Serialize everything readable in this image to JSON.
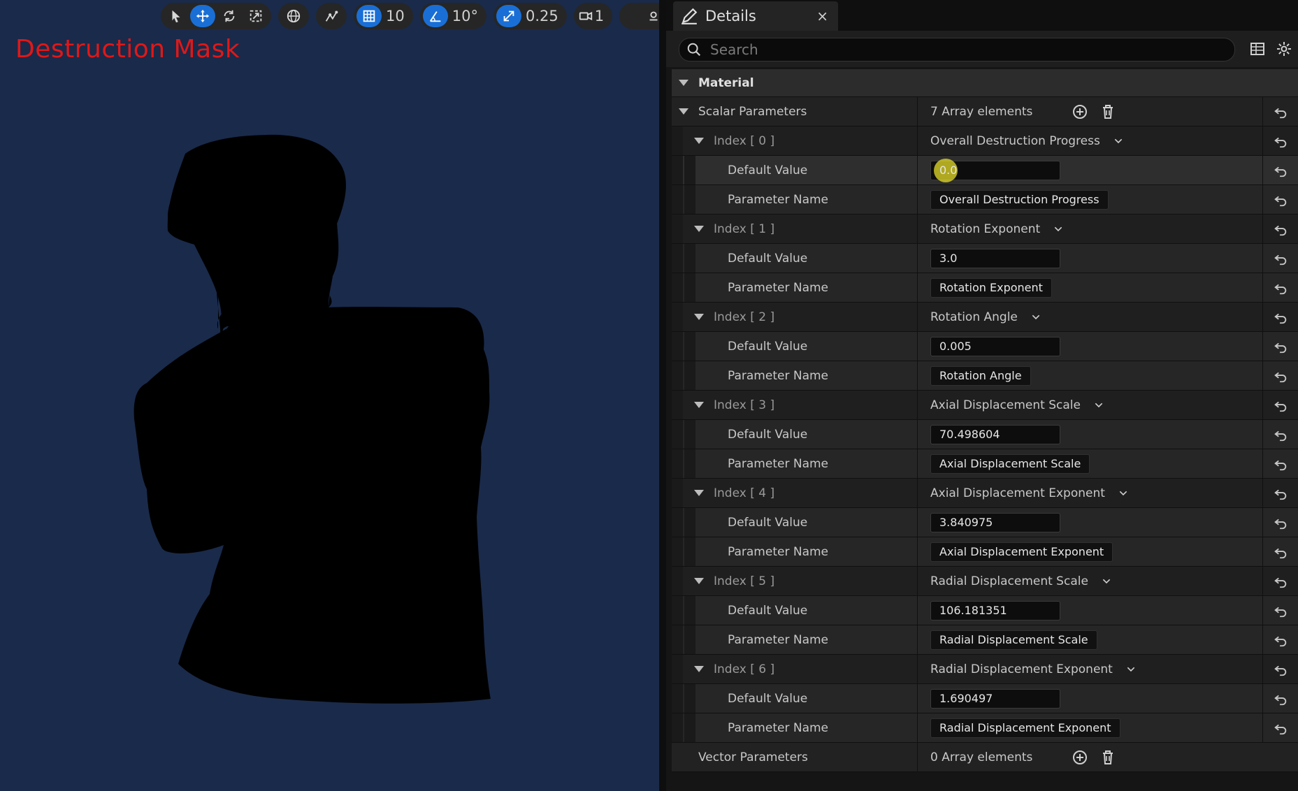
{
  "viewport": {
    "title": "Destruction Mask",
    "background": "#1a2a4a",
    "toolbar": {
      "grid_snap": "10",
      "rotation_snap": "10°",
      "scale_snap": "0.25",
      "camera_speed": "1"
    }
  },
  "details": {
    "tab_label": "Details",
    "close_glyph": "×",
    "search_placeholder": "Search",
    "category": "Material",
    "scalar_label": "Scalar Parameters",
    "scalar_count": "7 Array elements",
    "items": [
      {
        "index_label": "Index [ 0 ]",
        "combo": "Overall Destruction Progress",
        "default_label": "Default Value",
        "default_value": "0.0",
        "name_label": "Parameter Name",
        "name_value": "Overall Destruction Progress"
      },
      {
        "index_label": "Index [ 1 ]",
        "combo": "Rotation Exponent",
        "default_label": "Default Value",
        "default_value": "3.0",
        "name_label": "Parameter Name",
        "name_value": "Rotation Exponent"
      },
      {
        "index_label": "Index [ 2 ]",
        "combo": "Rotation Angle",
        "default_label": "Default Value",
        "default_value": "0.005",
        "name_label": "Parameter Name",
        "name_value": "Rotation Angle"
      },
      {
        "index_label": "Index [ 3 ]",
        "combo": "Axial Displacement Scale",
        "default_label": "Default Value",
        "default_value": "70.498604",
        "name_label": "Parameter Name",
        "name_value": "Axial Displacement Scale"
      },
      {
        "index_label": "Index [ 4 ]",
        "combo": "Axial Displacement Exponent",
        "default_label": "Default Value",
        "default_value": "3.840975",
        "name_label": "Parameter Name",
        "name_value": "Axial Displacement Exponent"
      },
      {
        "index_label": "Index [ 5 ]",
        "combo": "Radial Displacement Scale",
        "default_label": "Default Value",
        "default_value": "106.181351",
        "name_label": "Parameter Name",
        "name_value": "Radial Displacement Scale"
      },
      {
        "index_label": "Index [ 6 ]",
        "combo": "Radial Displacement Exponent",
        "default_label": "Default Value",
        "default_value": "1.690497",
        "name_label": "Parameter Name",
        "name_value": "Radial Displacement Exponent"
      }
    ],
    "vector_label": "Vector Parameters",
    "vector_count": "0 Array elements"
  }
}
